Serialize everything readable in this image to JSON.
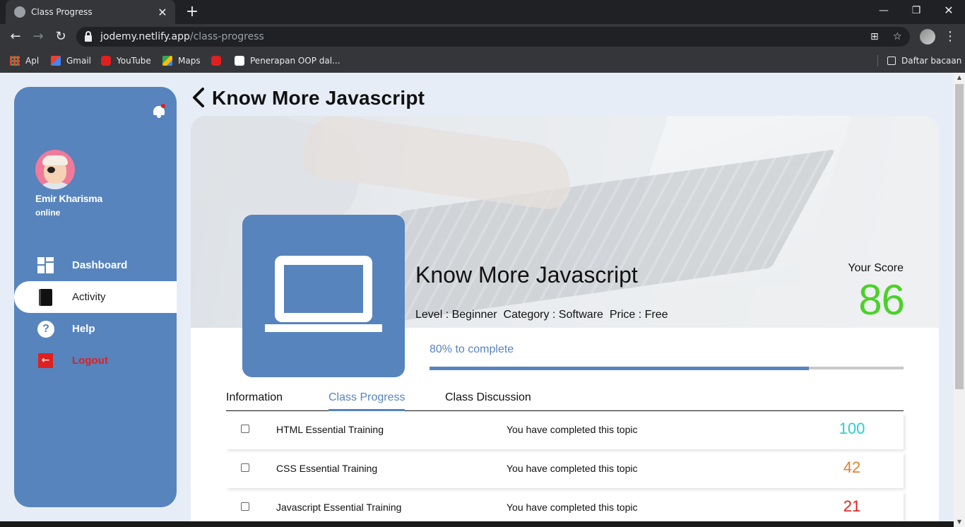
{
  "browser": {
    "tab_title": "Class Progress",
    "url_host": "jodemy.netlify.app",
    "url_path": "/class-progress",
    "bookmarks": [
      {
        "label": "Apl",
        "icon": "apps-grid-icon"
      },
      {
        "label": "Gmail",
        "icon": "gmail-icon"
      },
      {
        "label": "YouTube",
        "icon": "youtube-icon"
      },
      {
        "label": "Maps",
        "icon": "maps-icon"
      },
      {
        "label": "",
        "icon": "youtube-icon"
      },
      {
        "label": "Penerapan OOP dal...",
        "icon": "medium-icon"
      }
    ],
    "reading_list": "Daftar bacaan"
  },
  "sidebar": {
    "user_name": "Emir Kharisma",
    "user_status": "online",
    "items": [
      {
        "label": "Dashboard",
        "icon": "dashboard-icon",
        "active": false
      },
      {
        "label": "Activity",
        "icon": "book-icon",
        "active": true
      },
      {
        "label": "Help",
        "icon": "help-icon",
        "active": false
      },
      {
        "label": "Logout",
        "icon": "logout-icon",
        "active": false
      }
    ]
  },
  "header": {
    "title": "Know More Javascript"
  },
  "course": {
    "name": "Know More Javascript",
    "meta": "Level : Beginner  Category : Software  Price : Free",
    "score_label": "Your Score",
    "score": "86",
    "progress_label": "80% to complete",
    "progress": 0.8
  },
  "tabs": [
    {
      "label": "Information",
      "active": false
    },
    {
      "label": "Class Progress",
      "active": true
    },
    {
      "label": "Class Discussion",
      "active": false
    }
  ],
  "topics": [
    {
      "title": "HTML Essential Training",
      "message": "You have completed this topic",
      "score": "100",
      "score_color": "#2bd0c9"
    },
    {
      "title": "CSS Essential Training",
      "message": "You have completed this topic",
      "score": "42",
      "score_color": "#e0812e"
    },
    {
      "title": "Javascript Essential Training",
      "message": "You have completed this topic",
      "score": "21",
      "score_color": "#e02020"
    }
  ],
  "colors": {
    "primary": "#5784bd",
    "score_green": "#4cd12a",
    "logout_red": "#e0201e"
  }
}
